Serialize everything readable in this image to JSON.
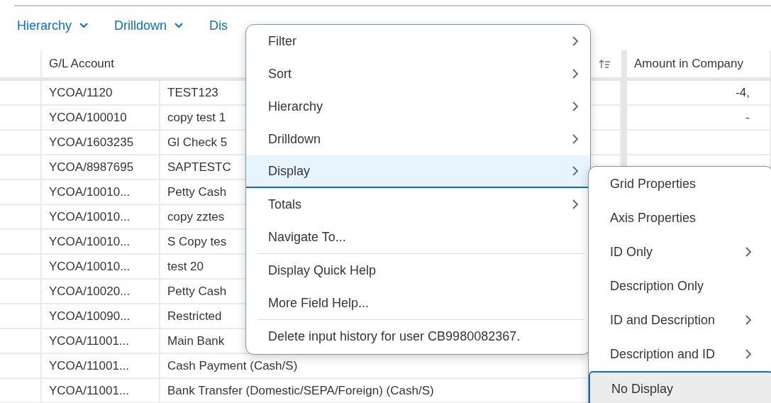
{
  "toolbar": [
    {
      "label": "Hierarchy",
      "dropdown": true
    },
    {
      "label": "Drilldown",
      "dropdown": true
    },
    {
      "label": "Dis",
      "dropdown": false
    }
  ],
  "table": {
    "columns": [
      {
        "label": "G/L Account"
      },
      {
        "label": "Amount in Company"
      }
    ],
    "rows": [
      {
        "account": "YCOA/1120",
        "description": "TEST123",
        "amount": "-4,"
      },
      {
        "account": "YCOA/100010",
        "description": "copy test 1",
        "amount": "-"
      },
      {
        "account": "YCOA/1603235",
        "description": "Gl Check 5"
      },
      {
        "account": "YCOA/8987695",
        "description": "SAPTESTC"
      },
      {
        "account": "YCOA/10010...",
        "description": "Petty Cash"
      },
      {
        "account": "YCOA/10010...",
        "description": "copy zztes"
      },
      {
        "account": "YCOA/10010...",
        "description": "S Copy tes"
      },
      {
        "account": "YCOA/10010...",
        "description": "test 20"
      },
      {
        "account": "YCOA/10020...",
        "description": "Petty Cash"
      },
      {
        "account": "YCOA/10090...",
        "description": "Restricted"
      },
      {
        "account": "YCOA/11001...",
        "description": "Main Bank"
      },
      {
        "account": "YCOA/11001...",
        "description": "Cash Payment (Cash/S)"
      },
      {
        "account": "YCOA/11001...",
        "description": "Bank Transfer (Domestic/SEPA/Foreign) (Cash/S)"
      }
    ]
  },
  "context_menu": {
    "items": [
      {
        "label": "Filter",
        "submenu": true,
        "selected": false,
        "divider_after": false
      },
      {
        "label": "Sort",
        "submenu": true,
        "selected": false,
        "divider_after": false
      },
      {
        "label": "Hierarchy",
        "submenu": true,
        "selected": false,
        "divider_after": false
      },
      {
        "label": "Drilldown",
        "submenu": true,
        "selected": false,
        "divider_after": false
      },
      {
        "label": "Display",
        "submenu": true,
        "selected": true,
        "divider_after": false
      },
      {
        "label": "Totals",
        "submenu": true,
        "selected": false,
        "divider_after": false
      },
      {
        "label": "Navigate To...",
        "submenu": false,
        "selected": false,
        "divider_after": true
      },
      {
        "label": "Display Quick Help",
        "submenu": false,
        "selected": false,
        "divider_after": false
      },
      {
        "label": "More Field Help...",
        "submenu": false,
        "selected": false,
        "divider_after": true
      },
      {
        "label": "Delete input history for user CB9980082367.",
        "submenu": false,
        "selected": false,
        "divider_after": false
      }
    ]
  },
  "submenu": {
    "items": [
      {
        "label": "Grid Properties",
        "submenu": false,
        "selected": false
      },
      {
        "label": "Axis Properties",
        "submenu": false,
        "selected": false
      },
      {
        "label": "ID Only",
        "submenu": true,
        "selected": false
      },
      {
        "label": "Description Only",
        "submenu": false,
        "selected": false
      },
      {
        "label": "ID and Description",
        "submenu": true,
        "selected": false
      },
      {
        "label": "Description and ID",
        "submenu": true,
        "selected": false
      },
      {
        "label": "No Display",
        "submenu": false,
        "selected": true
      }
    ]
  }
}
